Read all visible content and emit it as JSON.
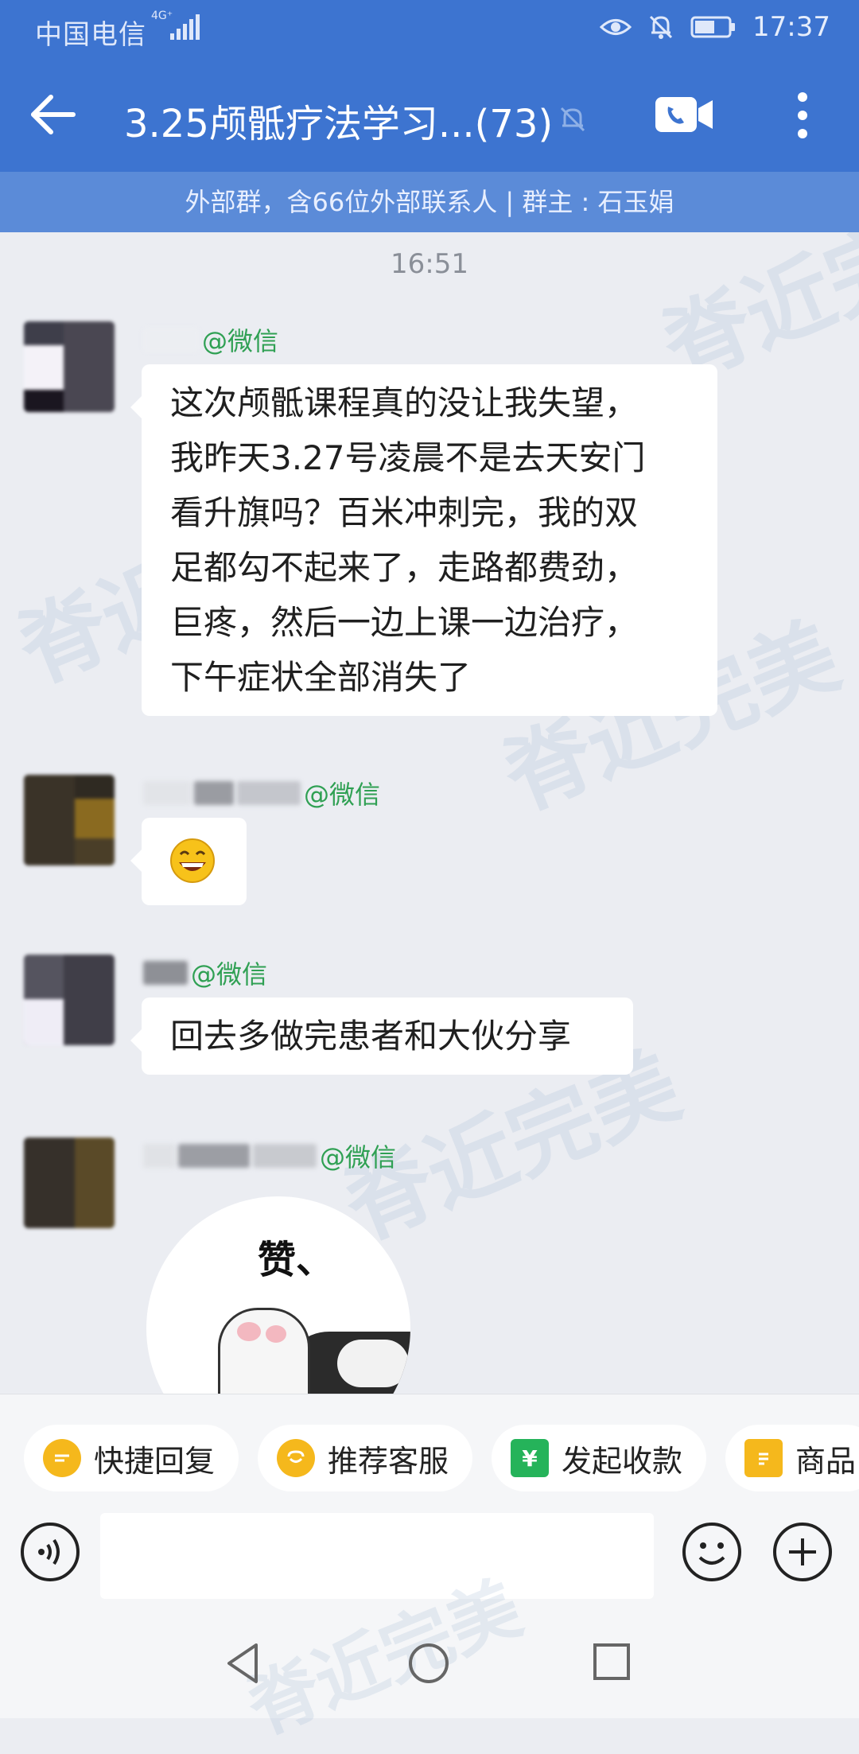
{
  "status_bar": {
    "carrier": "中国电信",
    "network": "4G⁺",
    "time": "17:37",
    "icons": [
      "signal-icon",
      "eye-icon",
      "bell-off-icon",
      "battery-icon"
    ]
  },
  "header": {
    "title": "3.25颅骶疗法学习...(73)",
    "group_info": "外部群，含66位外部联系人 | 群主 : 石玉娟",
    "icons": [
      "back-arrow-icon",
      "bell-off-icon",
      "video-call-icon",
      "more-vertical-icon"
    ]
  },
  "chat": {
    "timestamp": "16:51",
    "watermark": "脊近完美",
    "messages": [
      {
        "sender_tag": "@微信",
        "lines": [
          "这次颅骶课程真的没让我失望，",
          "我昨天3.27号凌晨不是去天安门",
          "看升旗吗？百米冲刺完，我的双",
          "足都勾不起来了，走路都费劲，",
          "巨疼，然后一边上课一边治疗，",
          "下午症状全部消失了"
        ]
      },
      {
        "sender_tag": "@微信",
        "emoji": "grinning-face-emoji"
      },
      {
        "sender_tag": "@微信",
        "lines": [
          "回去多做完患者和大伙分享"
        ]
      },
      {
        "sender_tag": "@微信",
        "sticker_text": "赞、"
      }
    ]
  },
  "quick_replies": [
    {
      "label": "快捷回复",
      "icon": "quick-reply-icon",
      "color": "#f5b81c"
    },
    {
      "label": "推荐客服",
      "icon": "customer-service-icon",
      "color": "#f5b81c"
    },
    {
      "label": "发起收款",
      "icon": "payment-icon",
      "color": "#25b35a"
    },
    {
      "label": "商品",
      "icon": "product-icon",
      "color": "#f5b81c"
    }
  ],
  "input": {
    "value": "",
    "placeholder": ""
  },
  "colors": {
    "header_blue": "#3d74d0",
    "subheader_blue": "#5b8bd8",
    "sender_green": "#2fa053",
    "background": "#ebedf2"
  }
}
